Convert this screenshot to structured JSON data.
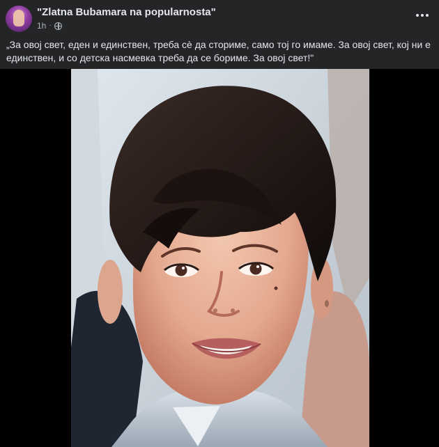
{
  "post": {
    "page_name": "\"Zlatna Bubamara na popularnosta\"",
    "time": "1h",
    "separator": "·",
    "caption": "„За овој свет, еден и единствен, треба сè да сториме, само тој го имаме. За овој свет, кој ни е единствен, и со детска насмевка треба да се бориме. За овој свет!\"",
    "icons": {
      "privacy": "globe-icon",
      "menu": "more-options-icon",
      "avatar": "page-avatar"
    }
  }
}
